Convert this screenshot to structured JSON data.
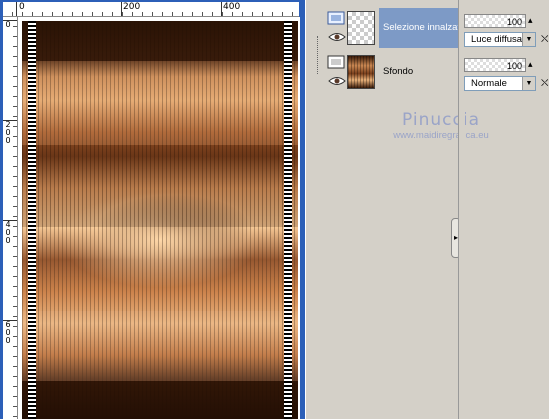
{
  "ruler": {
    "top_labels": [
      "0",
      "200",
      "400"
    ],
    "left_labels": [
      "0",
      "2\n0\n0",
      "4\n0\n0",
      "6\n0\n0"
    ]
  },
  "layers": [
    {
      "name": "Selezione innalzata",
      "opacity": "100",
      "blend": "Luce diffusa",
      "selected": true,
      "thumb": "transparent"
    },
    {
      "name": "Sfondo",
      "opacity": "100",
      "blend": "Normale",
      "selected": false,
      "thumb": "wood"
    }
  ],
  "watermark": {
    "title": "Pinuccia",
    "url": "www.maidiregrafica.eu"
  },
  "icons": {
    "eye": "eye-icon",
    "lock": "lock-icon",
    "collapse": "chevron-right-icon"
  },
  "colors": {
    "window_frame": "#2c5fb8",
    "selection_highlight": "#7d9ac6",
    "watermark": "#9aa4c8"
  }
}
